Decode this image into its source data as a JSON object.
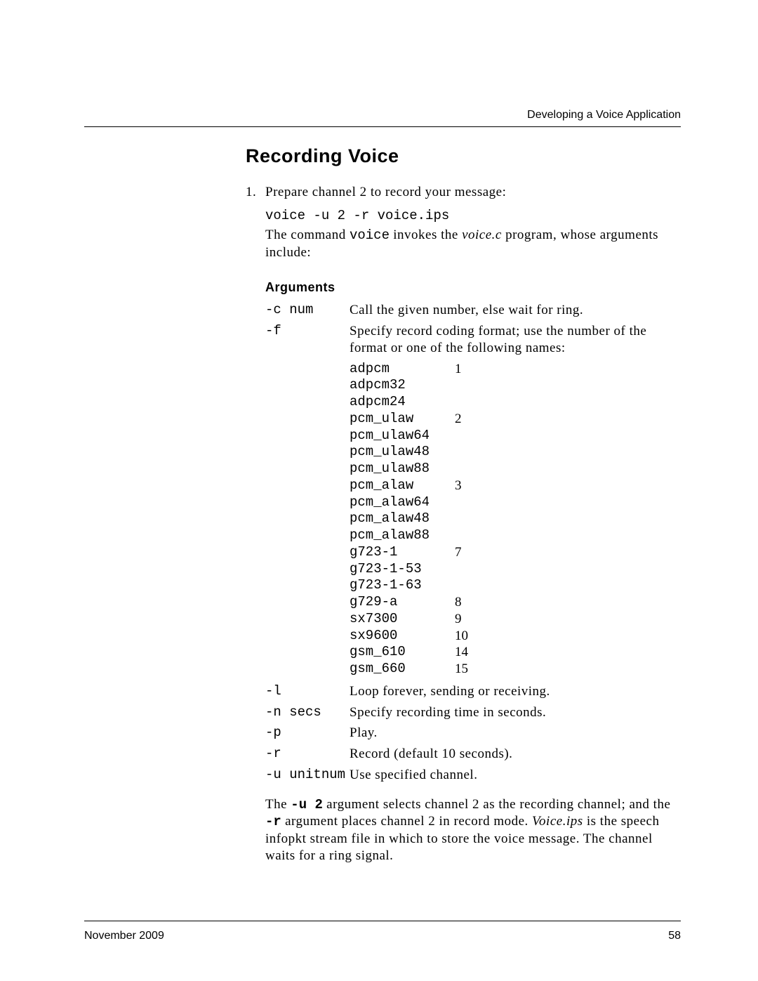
{
  "running_head": "Developing a Voice Application",
  "section_title": "Recording Voice",
  "step_number": "1.",
  "step_text": "Prepare channel 2 to record your message:",
  "command": "voice -u 2 -r voice.ips",
  "cmd_para_1": "The command ",
  "cmd_para_voice": "voice",
  "cmd_para_2": " invokes the ",
  "cmd_para_voicec": "voice.c",
  "cmd_para_3": " program, whose arguments include:",
  "arguments_head": "Arguments",
  "args": {
    "c": {
      "flag": "-c num",
      "desc": "Call the given number, else wait for ring."
    },
    "f": {
      "flag": "-f",
      "desc": "Specify record coding format; use the number of the format or one of the following names:"
    },
    "l": {
      "flag": "-l",
      "desc": "Loop forever, sending or receiving."
    },
    "n": {
      "flag": "-n secs",
      "desc": "Specify recording time in seconds."
    },
    "p": {
      "flag": "-p",
      "desc": "Play."
    },
    "r": {
      "flag": "-r",
      "desc": "Record (default 10 seconds)."
    },
    "u": {
      "flag": "-u unitnum",
      "desc": "Use specified channel."
    }
  },
  "formats": [
    {
      "name": "adpcm",
      "val": "1"
    },
    {
      "name": "adpcm32",
      "val": ""
    },
    {
      "name": "adpcm24",
      "val": ""
    },
    {
      "name": "pcm_ulaw",
      "val": "2"
    },
    {
      "name": "pcm_ulaw64",
      "val": ""
    },
    {
      "name": "pcm_ulaw48",
      "val": ""
    },
    {
      "name": "pcm_ulaw88",
      "val": ""
    },
    {
      "name": "pcm_alaw",
      "val": "3"
    },
    {
      "name": "pcm_alaw64",
      "val": ""
    },
    {
      "name": "pcm_alaw48",
      "val": ""
    },
    {
      "name": "pcm_alaw88",
      "val": ""
    },
    {
      "name": "g723-1",
      "val": "7"
    },
    {
      "name": "g723-1-53",
      "val": ""
    },
    {
      "name": "g723-1-63",
      "val": ""
    },
    {
      "name": "g729-a",
      "val": "8"
    },
    {
      "name": "sx7300",
      "val": "9"
    },
    {
      "name": "sx9600",
      "val": "10"
    },
    {
      "name": "gsm_610",
      "val": "14"
    },
    {
      "name": "gsm_660",
      "val": "15"
    }
  ],
  "closing": {
    "t1": "The ",
    "u2": "-u 2",
    "t2": " argument selects channel 2 as the recording channel; and the ",
    "r": "-r",
    "t3": " argument places channel 2 in record mode. ",
    "voice_ips": "Voice.ips",
    "t4": " is the speech infopkt stream file in which to store the voice message. The channel waits for a ring signal."
  },
  "footer_left": "November 2009",
  "footer_right": "58"
}
